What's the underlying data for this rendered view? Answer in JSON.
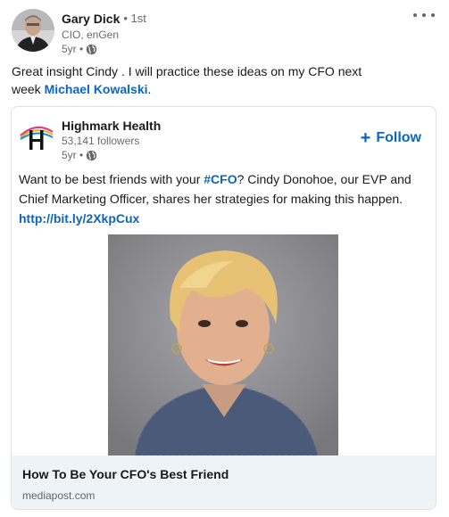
{
  "author": {
    "name": "Gary Dick",
    "degree": "• 1st",
    "headline": "CIO, enGen",
    "time": "5yr •"
  },
  "post": {
    "text_before": "Great insight Cindy . I will practice these ideas on my CFO next week ",
    "mention": "Michael Kowalski",
    "text_after": "."
  },
  "shared": {
    "org_name": "Highmark Health",
    "followers": "53,141 followers",
    "time": "5yr •",
    "follow_label": "Follow",
    "text_1": "Want to be best friends with your ",
    "hashtag": "#CFO",
    "text_2": "? Cindy Donohoe, our EVP and Chief Marketing Officer, shares her strategies for making this happen. ",
    "link": "http://bit.ly/2XkpCux",
    "article_title": "How To Be Your CFO's Best Friend",
    "article_domain": "mediapost.com"
  },
  "colors": {
    "link": "#0a66c2",
    "footer_bg": "#eef3f8"
  },
  "icons": {
    "more": "ellipsis-icon",
    "visibility": "globe-icon",
    "follow": "plus-icon"
  }
}
